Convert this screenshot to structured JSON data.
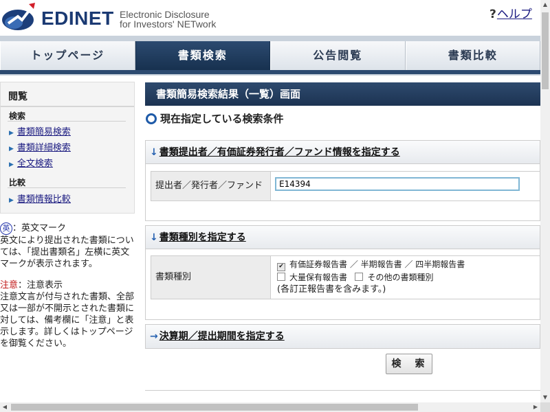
{
  "header": {
    "logo_text": "EDINET",
    "logo_sub_line1": "Electronic Disclosure",
    "logo_sub_line2": "for Investors' NETwork",
    "help_icon": "?",
    "help_label": "ヘルプ"
  },
  "nav": {
    "tabs": [
      {
        "label": "トップページ",
        "active": false
      },
      {
        "label": "書類検索",
        "active": true
      },
      {
        "label": "公告閲覧",
        "active": false
      },
      {
        "label": "書類比較",
        "active": false
      }
    ]
  },
  "sidebar": {
    "title": "閲覧",
    "sections": [
      {
        "label": "検索",
        "links": [
          "書類簡易検索",
          "書類詳細検索",
          "全文検索"
        ]
      },
      {
        "label": "比較",
        "links": [
          "書類情報比較"
        ]
      }
    ]
  },
  "notes": {
    "english_mark_icon": "英",
    "english_mark_title": "：英文マーク",
    "english_mark_desc": "英文により提出された書類については、「提出書類名」左横に英文マークが表示されます。",
    "caution_label": "注意",
    "caution_title": "：注意表示",
    "caution_desc": "注意文言が付与された書類、全部又は一部が不開示とされた書類に対しては、備考欄に「注意」と表示します。詳しくはトップページを御覧ください。"
  },
  "main": {
    "title": "書類簡易検索結果（一覧）画面",
    "condition_heading": "現在指定している検索条件",
    "panel1": {
      "heading": "書類提出者／有価証券発行者／ファンド情報を指定する",
      "field_label": "提出者／発行者／ファンド",
      "field_value": "E14394"
    },
    "panel2": {
      "heading": "書類種別を指定する",
      "field_label": "書類種別",
      "options": [
        {
          "label": "有価証券報告書 ／ 半期報告書 ／ 四半期報告書",
          "checked": true
        },
        {
          "label": "大量保有報告書",
          "checked": false
        },
        {
          "label": "その他の書類種別",
          "checked": false
        }
      ],
      "note": "(各訂正報告書を含みます。)"
    },
    "panel3": {
      "heading": "決算期／提出期間を指定する"
    },
    "search_button": "検　索"
  },
  "colors": {
    "brand_navy": "#1b3a73",
    "active_tab": "#2c4a70",
    "accent_blue": "#2560b0",
    "caution_red": "#c01818"
  }
}
